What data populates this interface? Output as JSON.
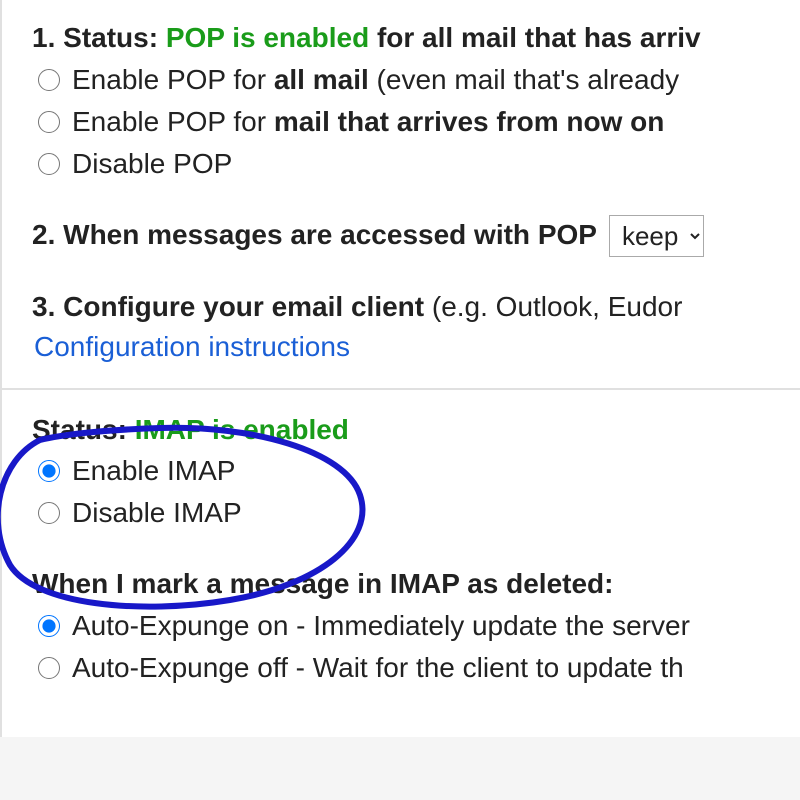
{
  "pop": {
    "heading_num": "1.",
    "heading_label": "Status:",
    "status_text": "POP is enabled",
    "heading_suffix": " for all mail that has arriv",
    "opt1_prefix": "Enable POP for ",
    "opt1_bold": "all mail",
    "opt1_suffix": " (even mail that's already",
    "opt2_prefix": "Enable POP for ",
    "opt2_bold": "mail that arrives from now on",
    "opt3": "Disable POP"
  },
  "pop_access": {
    "heading_num": "2.",
    "heading_text": "When messages are accessed with POP",
    "select_value": "keep"
  },
  "configure": {
    "heading_num": "3.",
    "heading_text": "Configure your email client",
    "heading_suffix": " (e.g. Outlook, Eudor",
    "link_text": "Configuration instructions"
  },
  "imap": {
    "status_label": "Status:",
    "status_text": "IMAP is enabled",
    "opt_enable": "Enable IMAP",
    "opt_disable": "Disable IMAP"
  },
  "expunge": {
    "heading": "When I mark a message in IMAP as deleted:",
    "opt_on": "Auto-Expunge on - Immediately update the server",
    "opt_off": "Auto-Expunge off - Wait for the client to update th"
  }
}
